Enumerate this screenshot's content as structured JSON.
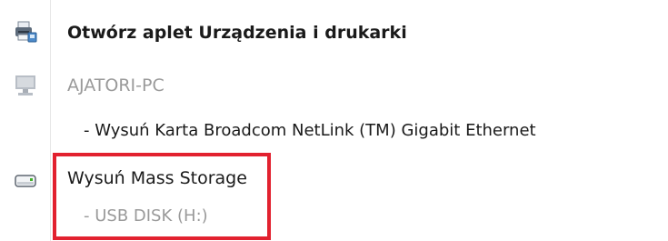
{
  "menu": {
    "items": [
      {
        "label": "Otwórz aplet Urządzenia i drukarki",
        "icon": "printer-devices-icon",
        "enabled": true
      },
      {
        "label": "AJATORI-PC",
        "icon": "computer-icon",
        "enabled": false
      },
      {
        "label": "- Wysuń Karta Broadcom NetLink (TM) Gigabit Ethernet",
        "enabled": true
      },
      {
        "label": "Wysuń Mass Storage",
        "icon": "usb-drive-icon",
        "enabled": true
      },
      {
        "label": "- USB  DISK (H:)",
        "enabled": false
      }
    ]
  },
  "highlight": {
    "color": "#e2212f"
  }
}
